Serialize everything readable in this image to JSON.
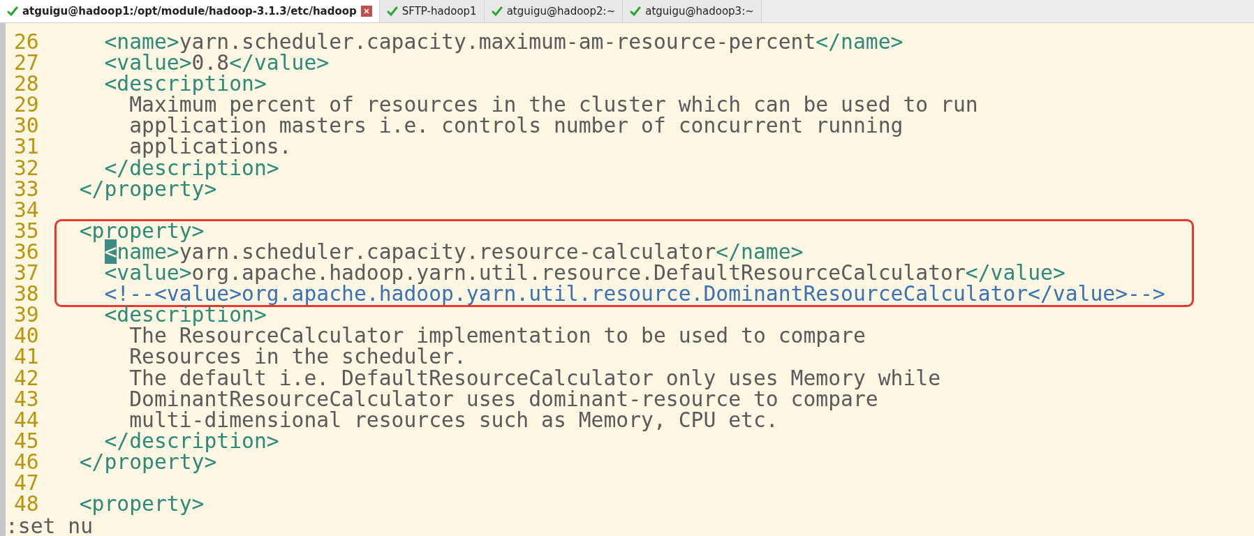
{
  "tabs": [
    {
      "label": "atguigu@hadoop1:/opt/module/hadoop-3.1.3/etc/hadoop",
      "selected": true
    },
    {
      "label": "SFTP-hadoop1",
      "selected": false
    },
    {
      "label": "atguigu@hadoop2:~",
      "selected": false
    },
    {
      "label": "atguigu@hadoop3:~",
      "selected": false
    }
  ],
  "editor": {
    "blocks": [
      {
        "highlighted": false,
        "lines": [
          {
            "number": "26",
            "segments": [
              {
                "kind": "tag",
                "text": "    <name>"
              },
              {
                "kind": "text",
                "text": "yarn.scheduler.capacity.maximum-am-resource-percent"
              },
              {
                "kind": "tag",
                "text": "</name>"
              }
            ]
          },
          {
            "number": "27",
            "segments": [
              {
                "kind": "tag",
                "text": "    <value>"
              },
              {
                "kind": "text",
                "text": "0.8"
              },
              {
                "kind": "tag",
                "text": "</value>"
              }
            ]
          },
          {
            "number": "28",
            "segments": [
              {
                "kind": "tag",
                "text": "    <description>"
              }
            ]
          },
          {
            "number": "29",
            "segments": [
              {
                "kind": "text",
                "text": "      Maximum percent of resources in the cluster which can be used to run"
              }
            ]
          },
          {
            "number": "30",
            "segments": [
              {
                "kind": "text",
                "text": "      application masters i.e. controls number of concurrent running"
              }
            ]
          },
          {
            "number": "31",
            "segments": [
              {
                "kind": "text",
                "text": "      applications."
              }
            ]
          },
          {
            "number": "32",
            "segments": [
              {
                "kind": "tag",
                "text": "    </description>"
              }
            ]
          },
          {
            "number": "33",
            "segments": [
              {
                "kind": "tag",
                "text": "  </property>"
              }
            ]
          },
          {
            "number": "34"
          }
        ]
      },
      {
        "highlighted": true,
        "lines": [
          {
            "number": "35",
            "segments": [
              {
                "kind": "tag",
                "text": "  <property>"
              }
            ]
          },
          {
            "number": "36",
            "segments": [
              {
                "kind": "cursor",
                "text": "    <"
              },
              {
                "kind": "tag",
                "text": "name>"
              },
              {
                "kind": "text",
                "text": "yarn.scheduler.capacity.resource-calculator"
              },
              {
                "kind": "tag",
                "text": "</name>"
              }
            ]
          },
          {
            "number": "37",
            "segments": [
              {
                "kind": "tag",
                "text": "    <value>"
              },
              {
                "kind": "text",
                "text": "org.apache.hadoop.yarn.util.resource.DefaultResourceCalculator"
              },
              {
                "kind": "tag",
                "text": "</value>"
              }
            ]
          },
          {
            "number": "38",
            "segments": [
              {
                "kind": "comment",
                "text": "    <!--<value>org.apache.hadoop.yarn.util.resource.DominantResourceCalculator</value>-->"
              }
            ]
          }
        ]
      },
      {
        "highlighted": false,
        "lines": [
          {
            "number": "39",
            "segments": [
              {
                "kind": "tag",
                "text": "    <description>"
              }
            ]
          },
          {
            "number": "40",
            "segments": [
              {
                "kind": "text",
                "text": "      The ResourceCalculator implementation to be used to compare"
              }
            ]
          },
          {
            "number": "41",
            "segments": [
              {
                "kind": "text",
                "text": "      Resources in the scheduler."
              }
            ]
          },
          {
            "number": "42",
            "segments": [
              {
                "kind": "text",
                "text": "      The default i.e. DefaultResourceCalculator only uses Memory while"
              }
            ]
          },
          {
            "number": "43",
            "segments": [
              {
                "kind": "text",
                "text": "      DominantResourceCalculator uses dominant-resource to compare"
              }
            ]
          },
          {
            "number": "44",
            "segments": [
              {
                "kind": "text",
                "text": "      multi-dimensional resources such as Memory, CPU etc."
              }
            ]
          },
          {
            "number": "45",
            "segments": [
              {
                "kind": "tag",
                "text": "    </description>"
              }
            ]
          },
          {
            "number": "46",
            "segments": [
              {
                "kind": "tag",
                "text": "  </property>"
              }
            ]
          },
          {
            "number": "47"
          },
          {
            "number": "48",
            "segments": [
              {
                "kind": "tag",
                "text": "  <property>"
              }
            ]
          }
        ]
      }
    ]
  },
  "command_line": ":set nu"
}
